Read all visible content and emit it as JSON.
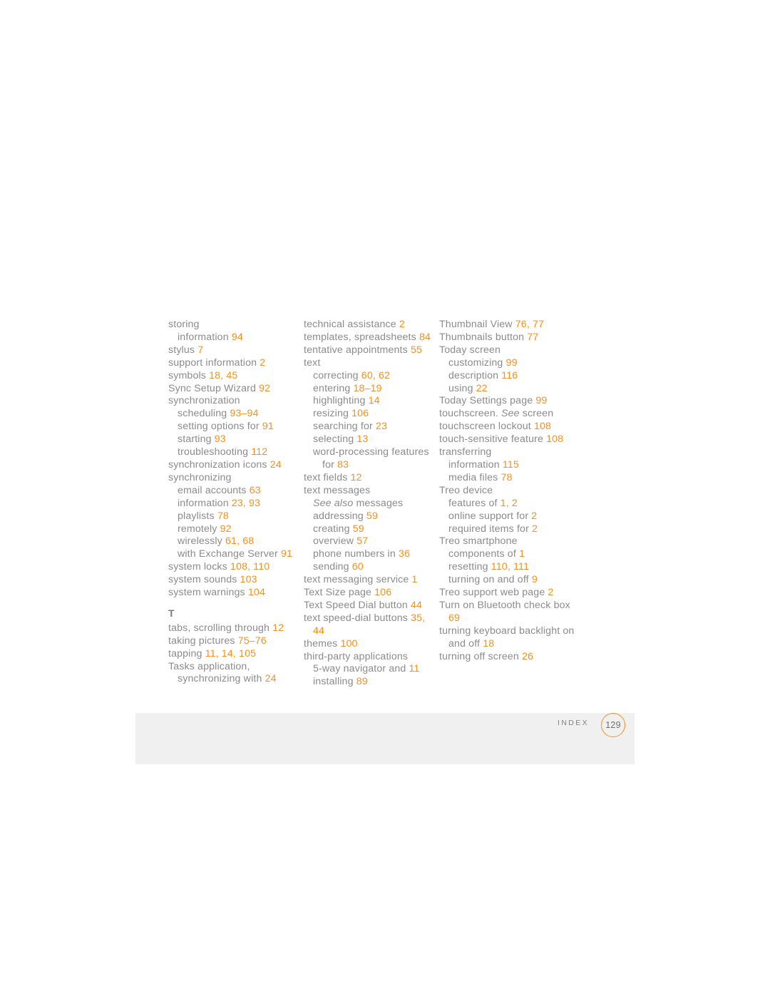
{
  "document": {
    "kind": "printed-index-page",
    "footer": {
      "section_label": "INDEX",
      "page_number": "129"
    },
    "colors": {
      "text": "#8b8b8b",
      "page_number_accent": "#f4901e",
      "footer_band": "#f0f0f0",
      "page_background": "#ffffff"
    }
  },
  "columns": [
    {
      "id": "column-1",
      "entries": [
        {
          "level": 1,
          "parts": [
            {
              "t": "storing"
            }
          ]
        },
        {
          "level": 2,
          "parts": [
            {
              "t": "information "
            },
            {
              "t": "94",
              "k": "num"
            }
          ]
        },
        {
          "level": 1,
          "parts": [
            {
              "t": "stylus "
            },
            {
              "t": "7",
              "k": "num"
            }
          ]
        },
        {
          "level": 1,
          "parts": [
            {
              "t": "support information "
            },
            {
              "t": "2",
              "k": "num"
            }
          ]
        },
        {
          "level": 1,
          "parts": [
            {
              "t": "symbols "
            },
            {
              "t": "18, 45",
              "k": "num"
            }
          ]
        },
        {
          "level": 1,
          "parts": [
            {
              "t": "Sync Setup Wizard "
            },
            {
              "t": "92",
              "k": "num"
            }
          ]
        },
        {
          "level": 1,
          "parts": [
            {
              "t": "synchronization"
            }
          ]
        },
        {
          "level": 2,
          "parts": [
            {
              "t": "scheduling "
            },
            {
              "t": "93–94",
              "k": "num"
            }
          ]
        },
        {
          "level": 2,
          "parts": [
            {
              "t": "setting options for "
            },
            {
              "t": "91",
              "k": "num"
            }
          ]
        },
        {
          "level": 2,
          "parts": [
            {
              "t": "starting "
            },
            {
              "t": "93",
              "k": "num"
            }
          ]
        },
        {
          "level": 2,
          "parts": [
            {
              "t": "troubleshooting "
            },
            {
              "t": "112",
              "k": "num"
            }
          ]
        },
        {
          "level": 1,
          "parts": [
            {
              "t": "synchronization icons "
            },
            {
              "t": "24",
              "k": "num"
            }
          ]
        },
        {
          "level": 1,
          "parts": [
            {
              "t": "synchronizing"
            }
          ]
        },
        {
          "level": 2,
          "parts": [
            {
              "t": "email accounts "
            },
            {
              "t": "63",
              "k": "num"
            }
          ]
        },
        {
          "level": 2,
          "parts": [
            {
              "t": "information "
            },
            {
              "t": "23, 93",
              "k": "num"
            }
          ]
        },
        {
          "level": 2,
          "parts": [
            {
              "t": "playlists "
            },
            {
              "t": "78",
              "k": "num"
            }
          ]
        },
        {
          "level": 2,
          "parts": [
            {
              "t": "remotely "
            },
            {
              "t": "92",
              "k": "num"
            }
          ]
        },
        {
          "level": 2,
          "parts": [
            {
              "t": "wirelessly "
            },
            {
              "t": "61, 68",
              "k": "num"
            }
          ]
        },
        {
          "level": 2,
          "parts": [
            {
              "t": "with Exchange Server "
            },
            {
              "t": "91",
              "k": "num"
            }
          ]
        },
        {
          "level": 1,
          "parts": [
            {
              "t": "system locks "
            },
            {
              "t": "108, 110",
              "k": "num"
            }
          ]
        },
        {
          "level": 1,
          "parts": [
            {
              "t": "system sounds "
            },
            {
              "t": "103",
              "k": "num"
            }
          ]
        },
        {
          "level": 1,
          "parts": [
            {
              "t": "system warnings "
            },
            {
              "t": "104",
              "k": "num"
            }
          ]
        },
        {
          "level": 0,
          "heading": "T"
        },
        {
          "level": 1,
          "parts": [
            {
              "t": "tabs, scrolling through "
            },
            {
              "t": "12",
              "k": "num"
            }
          ]
        },
        {
          "level": 1,
          "parts": [
            {
              "t": "taking pictures "
            },
            {
              "t": "75–76",
              "k": "num"
            }
          ]
        },
        {
          "level": 1,
          "parts": [
            {
              "t": "tapping "
            },
            {
              "t": "11, 14, 105",
              "k": "num"
            }
          ]
        },
        {
          "level": 1,
          "parts": [
            {
              "t": "Tasks application,"
            }
          ]
        },
        {
          "level": 2,
          "parts": [
            {
              "t": "synchronizing with "
            },
            {
              "t": "24",
              "k": "num"
            }
          ]
        }
      ]
    },
    {
      "id": "column-2",
      "entries": [
        {
          "level": 1,
          "parts": [
            {
              "t": "technical assistance "
            },
            {
              "t": "2",
              "k": "num"
            }
          ]
        },
        {
          "level": 1,
          "parts": [
            {
              "t": "templates, spreadsheets "
            },
            {
              "t": "84",
              "k": "num"
            }
          ]
        },
        {
          "level": 1,
          "parts": [
            {
              "t": "tentative appointments "
            },
            {
              "t": "55",
              "k": "num"
            }
          ]
        },
        {
          "level": 1,
          "parts": [
            {
              "t": "text"
            }
          ]
        },
        {
          "level": 2,
          "parts": [
            {
              "t": "correcting "
            },
            {
              "t": "60, 62",
              "k": "num"
            }
          ]
        },
        {
          "level": 2,
          "parts": [
            {
              "t": "entering "
            },
            {
              "t": "18–19",
              "k": "num"
            }
          ]
        },
        {
          "level": 2,
          "parts": [
            {
              "t": "highlighting "
            },
            {
              "t": "14",
              "k": "num"
            }
          ]
        },
        {
          "level": 2,
          "parts": [
            {
              "t": "resizing "
            },
            {
              "t": "106",
              "k": "num"
            }
          ]
        },
        {
          "level": 2,
          "parts": [
            {
              "t": "searching for "
            },
            {
              "t": "23",
              "k": "num"
            }
          ]
        },
        {
          "level": 2,
          "parts": [
            {
              "t": "selecting "
            },
            {
              "t": "13",
              "k": "num"
            }
          ]
        },
        {
          "level": 2,
          "parts": [
            {
              "t": "word-processing features"
            }
          ]
        },
        {
          "level": 3,
          "parts": [
            {
              "t": "for "
            },
            {
              "t": "83",
              "k": "num"
            }
          ]
        },
        {
          "level": 1,
          "parts": [
            {
              "t": "text fields "
            },
            {
              "t": "12",
              "k": "num"
            }
          ]
        },
        {
          "level": 1,
          "parts": [
            {
              "t": "text messages"
            }
          ]
        },
        {
          "level": 2,
          "parts": [
            {
              "t": "See also",
              "k": "ital"
            },
            {
              "t": " messages"
            }
          ]
        },
        {
          "level": 2,
          "parts": [
            {
              "t": "addressing "
            },
            {
              "t": "59",
              "k": "num"
            }
          ]
        },
        {
          "level": 2,
          "parts": [
            {
              "t": "creating "
            },
            {
              "t": "59",
              "k": "num"
            }
          ]
        },
        {
          "level": 2,
          "parts": [
            {
              "t": "overview "
            },
            {
              "t": "57",
              "k": "num"
            }
          ]
        },
        {
          "level": 2,
          "parts": [
            {
              "t": "phone numbers in "
            },
            {
              "t": "36",
              "k": "num"
            }
          ]
        },
        {
          "level": 2,
          "parts": [
            {
              "t": "sending "
            },
            {
              "t": "60",
              "k": "num"
            }
          ]
        },
        {
          "level": 1,
          "parts": [
            {
              "t": "text messaging service "
            },
            {
              "t": "1",
              "k": "num"
            }
          ]
        },
        {
          "level": 1,
          "parts": [
            {
              "t": "Text Size page "
            },
            {
              "t": "106",
              "k": "num"
            }
          ]
        },
        {
          "level": 1,
          "parts": [
            {
              "t": "Text Speed Dial button "
            },
            {
              "t": "44",
              "k": "num"
            }
          ]
        },
        {
          "level": 1,
          "parts": [
            {
              "t": "text speed-dial buttons "
            },
            {
              "t": "35,",
              "k": "num"
            }
          ]
        },
        {
          "level": 2,
          "parts": [
            {
              "t": "44",
              "k": "num"
            }
          ]
        },
        {
          "level": 1,
          "parts": [
            {
              "t": "themes "
            },
            {
              "t": "100",
              "k": "num"
            }
          ]
        },
        {
          "level": 1,
          "parts": [
            {
              "t": "third-party applications"
            }
          ]
        },
        {
          "level": 2,
          "parts": [
            {
              "t": "5-way navigator and "
            },
            {
              "t": "11",
              "k": "num"
            }
          ]
        },
        {
          "level": 2,
          "parts": [
            {
              "t": "installing "
            },
            {
              "t": "89",
              "k": "num"
            }
          ]
        }
      ]
    },
    {
      "id": "column-3",
      "entries": [
        {
          "level": 1,
          "parts": [
            {
              "t": "Thumbnail View "
            },
            {
              "t": "76, 77",
              "k": "num"
            }
          ]
        },
        {
          "level": 1,
          "parts": [
            {
              "t": "Thumbnails button "
            },
            {
              "t": "77",
              "k": "num"
            }
          ]
        },
        {
          "level": 1,
          "parts": [
            {
              "t": "Today screen"
            }
          ]
        },
        {
          "level": 2,
          "parts": [
            {
              "t": "customizing "
            },
            {
              "t": "99",
              "k": "num"
            }
          ]
        },
        {
          "level": 2,
          "parts": [
            {
              "t": "description "
            },
            {
              "t": "116",
              "k": "num"
            }
          ]
        },
        {
          "level": 2,
          "parts": [
            {
              "t": "using "
            },
            {
              "t": "22",
              "k": "num"
            }
          ]
        },
        {
          "level": 1,
          "parts": [
            {
              "t": "Today Settings page "
            },
            {
              "t": "99",
              "k": "num"
            }
          ]
        },
        {
          "level": 1,
          "parts": [
            {
              "t": "touchscreen. "
            },
            {
              "t": "See",
              "k": "ital"
            },
            {
              "t": " screen"
            }
          ]
        },
        {
          "level": 1,
          "parts": [
            {
              "t": "touchscreen lockout "
            },
            {
              "t": "108",
              "k": "num"
            }
          ]
        },
        {
          "level": 1,
          "parts": [
            {
              "t": "touch-sensitive feature "
            },
            {
              "t": "108",
              "k": "num"
            }
          ]
        },
        {
          "level": 1,
          "parts": [
            {
              "t": "transferring"
            }
          ]
        },
        {
          "level": 2,
          "parts": [
            {
              "t": "information "
            },
            {
              "t": "115",
              "k": "num"
            }
          ]
        },
        {
          "level": 2,
          "parts": [
            {
              "t": "media files "
            },
            {
              "t": "78",
              "k": "num"
            }
          ]
        },
        {
          "level": 1,
          "parts": [
            {
              "t": "Treo device"
            }
          ]
        },
        {
          "level": 2,
          "parts": [
            {
              "t": "features of "
            },
            {
              "t": "1, 2",
              "k": "num"
            }
          ]
        },
        {
          "level": 2,
          "parts": [
            {
              "t": "online support for "
            },
            {
              "t": "2",
              "k": "num"
            }
          ]
        },
        {
          "level": 2,
          "parts": [
            {
              "t": "required items for "
            },
            {
              "t": "2",
              "k": "num"
            }
          ]
        },
        {
          "level": 1,
          "parts": [
            {
              "t": "Treo smartphone"
            }
          ]
        },
        {
          "level": 2,
          "parts": [
            {
              "t": "components of "
            },
            {
              "t": "1",
              "k": "num"
            }
          ]
        },
        {
          "level": 2,
          "parts": [
            {
              "t": "resetting "
            },
            {
              "t": "110, 111",
              "k": "num"
            }
          ]
        },
        {
          "level": 2,
          "parts": [
            {
              "t": "turning on and off "
            },
            {
              "t": "9",
              "k": "num"
            }
          ]
        },
        {
          "level": 1,
          "parts": [
            {
              "t": "Treo support web page "
            },
            {
              "t": "2",
              "k": "num"
            }
          ]
        },
        {
          "level": 1,
          "parts": [
            {
              "t": "Turn on Bluetooth check box"
            }
          ]
        },
        {
          "level": 2,
          "parts": [
            {
              "t": "69",
              "k": "num"
            }
          ]
        },
        {
          "level": 1,
          "parts": [
            {
              "t": "turning keyboard backlight on"
            }
          ]
        },
        {
          "level": 2,
          "parts": [
            {
              "t": "and off "
            },
            {
              "t": "18",
              "k": "num"
            }
          ]
        },
        {
          "level": 1,
          "parts": [
            {
              "t": "turning off screen "
            },
            {
              "t": "26",
              "k": "num"
            }
          ]
        }
      ]
    }
  ]
}
